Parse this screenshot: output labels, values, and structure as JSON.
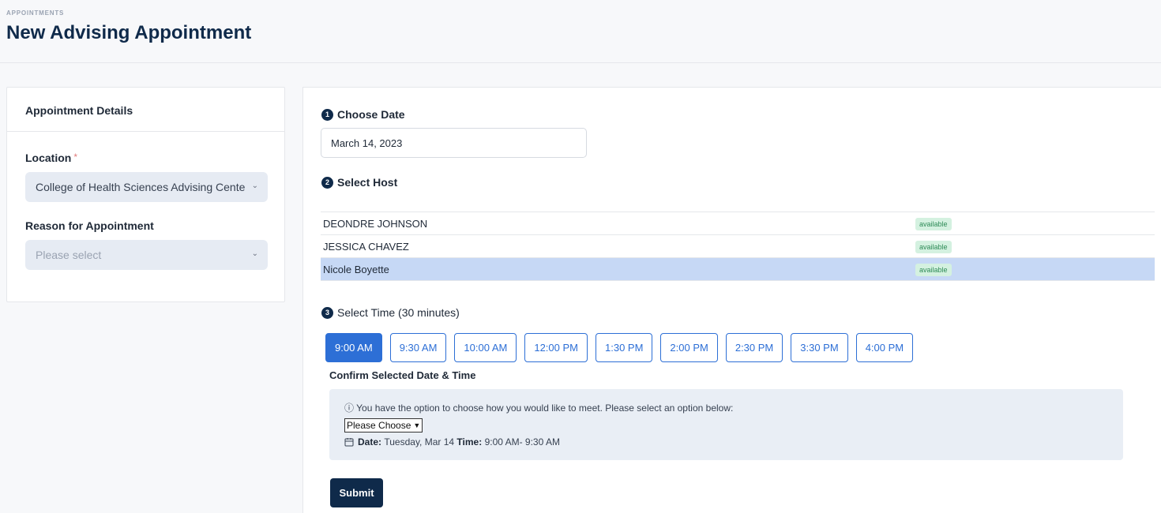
{
  "header": {
    "eyebrow": "APPOINTMENTS",
    "title": "New Advising Appointment"
  },
  "details": {
    "title": "Appointment Details",
    "location_label": "Location",
    "location_required": "*",
    "location_value": "College of Health Sciences Advising Cente",
    "reason_label": "Reason for Appointment",
    "reason_placeholder": "Please select"
  },
  "steps": {
    "date": {
      "num": "1",
      "label": "Choose Date",
      "value": "March 14, 2023"
    },
    "host": {
      "num": "2",
      "label": "Select Host"
    },
    "time": {
      "num": "3",
      "label": "Select Time (30 minutes)"
    }
  },
  "hosts": [
    {
      "name": "DEONDRE JOHNSON",
      "status": "available",
      "selected": false
    },
    {
      "name": "JESSICA CHAVEZ",
      "status": "available",
      "selected": false
    },
    {
      "name": "Nicole Boyette",
      "status": "available",
      "selected": true
    }
  ],
  "times": [
    "9:00 AM",
    "9:30 AM",
    "10:00 AM",
    "12:00 PM",
    "1:30 PM",
    "2:00 PM",
    "2:30 PM",
    "3:30 PM",
    "4:00 PM"
  ],
  "selected_time": "9:00 AM",
  "confirm": {
    "title": "Confirm Selected Date & Time",
    "info": "You have the option to choose how you would like to meet. Please select an option below:",
    "meet_select": "Please Choose",
    "date_label": "Date:",
    "date_value": "Tuesday, Mar 14",
    "time_label": "Time:",
    "time_value": "9:00 AM- 9:30 AM"
  },
  "submit_label": "Submit",
  "colors": {
    "primary": "#0f2a4a",
    "accent": "#2d6fd6",
    "selected_row": "#c6d8f5",
    "badge_bg": "#d4f1e0"
  }
}
